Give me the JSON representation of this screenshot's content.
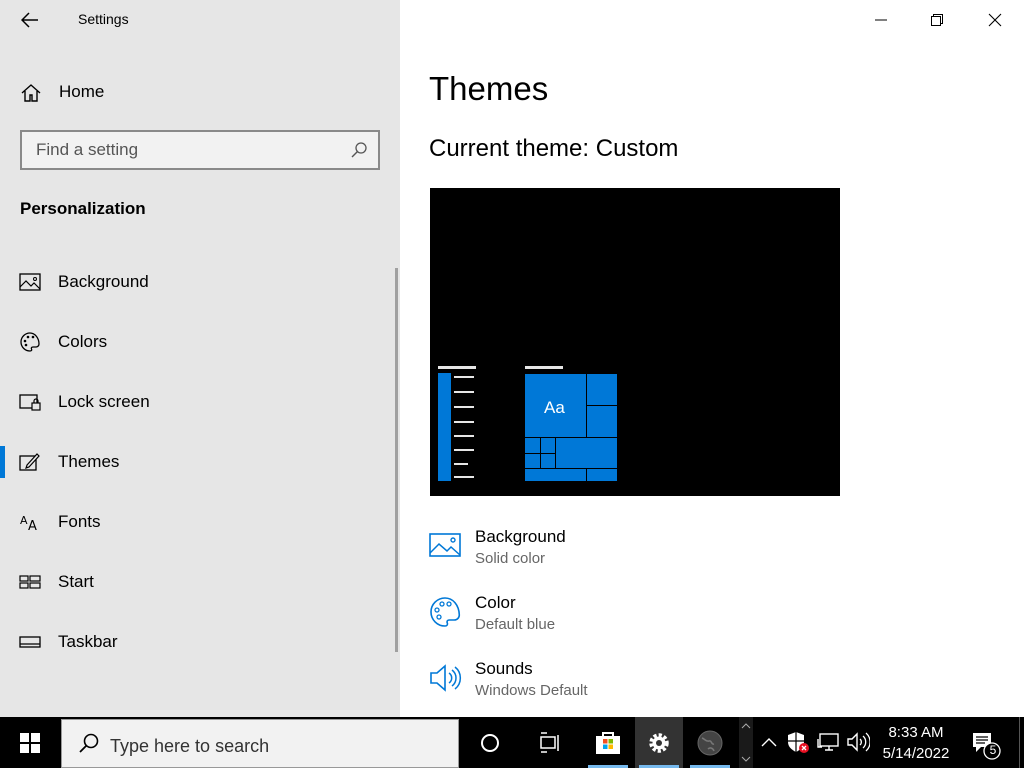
{
  "window": {
    "title": "Settings",
    "controls": {
      "minimize": "minimize",
      "restore": "restore",
      "close": "close"
    }
  },
  "sidebar": {
    "home_label": "Home",
    "search": {
      "placeholder": "Find a setting",
      "value": ""
    },
    "section_title": "Personalization",
    "items": [
      {
        "label": "Background",
        "icon": "picture-icon",
        "selected": false
      },
      {
        "label": "Colors",
        "icon": "palette-icon",
        "selected": false
      },
      {
        "label": "Lock screen",
        "icon": "lock-screen-icon",
        "selected": false
      },
      {
        "label": "Themes",
        "icon": "themes-brush-icon",
        "selected": true
      },
      {
        "label": "Fonts",
        "icon": "fonts-icon",
        "selected": false
      },
      {
        "label": "Start",
        "icon": "start-tiles-icon",
        "selected": false
      },
      {
        "label": "Taskbar",
        "icon": "taskbar-icon",
        "selected": false
      }
    ]
  },
  "main": {
    "title": "Themes",
    "current_theme": "Current theme: Custom",
    "preview": {
      "sample_text": "Aa",
      "accent": "#0078d7",
      "background": "#000000"
    },
    "properties": [
      {
        "name": "Background",
        "value": "Solid color",
        "icon": "picture-icon"
      },
      {
        "name": "Color",
        "value": "Default blue",
        "icon": "palette-icon"
      },
      {
        "name": "Sounds",
        "value": "Windows Default",
        "icon": "speaker-icon"
      }
    ]
  },
  "taskbar": {
    "search_placeholder": "Type here to search",
    "clock": {
      "time": "8:33 AM",
      "date": "5/14/2022"
    },
    "notification_count": "5"
  },
  "colors": {
    "accent": "#0078d7",
    "sidebar_bg": "#e6e6e6",
    "taskbar_bg": "#000000"
  }
}
